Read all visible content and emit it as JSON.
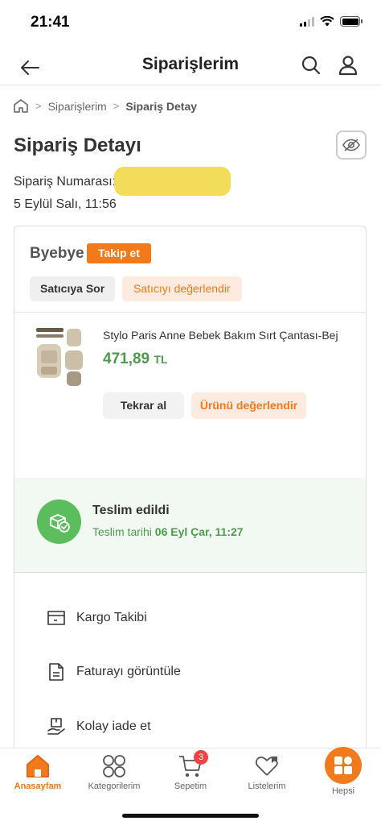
{
  "status_bar": {
    "time": "21:41"
  },
  "header": {
    "title": "Siparişlerim"
  },
  "breadcrumb": {
    "level1": "Siparişlerim",
    "current": "Sipariş Detay"
  },
  "page": {
    "title": "Sipariş Detayı",
    "order_number_label": "Sipariş Numarası:",
    "order_date": "5 Eylül Salı, 11:56"
  },
  "seller": {
    "name": "Byebye",
    "follow_label": "Takip et",
    "ask_label": "Satıcıya Sor",
    "rate_label": "Satıcıyı değerlendir"
  },
  "product": {
    "name": "Stylo Paris Anne Bebek Bakım Sırt Çantası-Bej",
    "price": "471,89",
    "currency": "TL",
    "reorder_label": "Tekrar al",
    "rate_label": "Ürünü değerlendir"
  },
  "delivery": {
    "status": "Teslim edildi",
    "date_label": "Teslim tarihi",
    "date_value": "06 Eyl Çar, 11:27"
  },
  "actions": [
    {
      "label": "Kargo Takibi",
      "icon": "box-icon"
    },
    {
      "label": "Faturayı görüntüle",
      "icon": "invoice-icon"
    },
    {
      "label": "Kolay iade et",
      "icon": "return-icon"
    }
  ],
  "bottom_nav": {
    "home": "Anasayfam",
    "categories": "Kategorilerim",
    "cart": "Sepetim",
    "cart_count": "3",
    "lists": "Listelerim",
    "all": "Hepsi"
  },
  "colors": {
    "accent": "#f27a1a",
    "success": "#4e9a4e"
  }
}
